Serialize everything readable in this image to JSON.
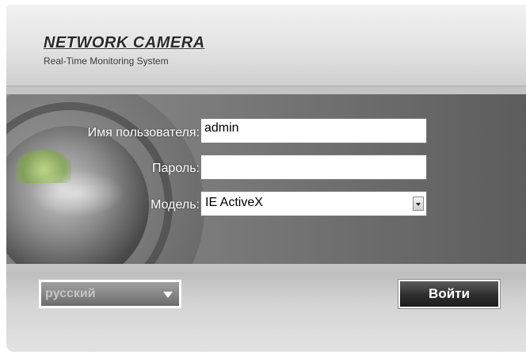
{
  "header": {
    "title": "NETWORK CAMERA",
    "subtitle": "Real-Time Monitoring System"
  },
  "form": {
    "username_label": "Имя пользователя:",
    "username_value": "admin",
    "password_label": "Пароль:",
    "password_value": "",
    "model_label": "Модель:",
    "model_value": "IE ActiveX"
  },
  "footer": {
    "language_value": "русский",
    "login_label": "Войти"
  }
}
